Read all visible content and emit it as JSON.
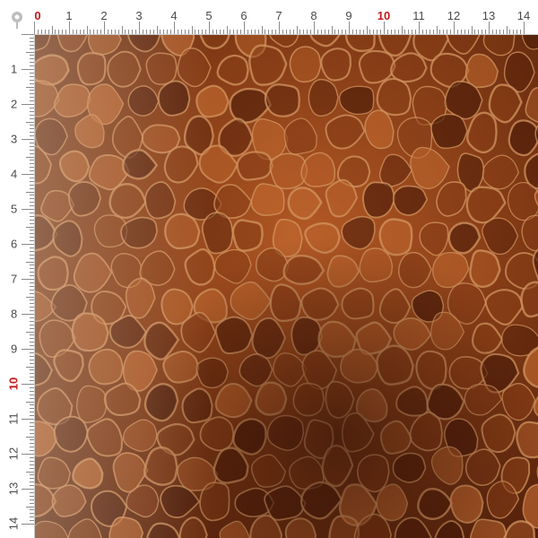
{
  "ruler": {
    "unit_labels": [
      "0",
      "1",
      "2",
      "3",
      "4",
      "5",
      "6",
      "7",
      "8",
      "9",
      "10",
      "11",
      "12",
      "13",
      "14"
    ],
    "highlight": [
      "0",
      "10"
    ],
    "highlight_color": "#c3191c"
  },
  "swatch": {
    "texture": "brown crocodile leather print",
    "colors": {
      "base_dark": "#4a1a08",
      "base_mid": "#8a3e16",
      "base_light": "#c56a30",
      "ridge": "#d89a63"
    }
  },
  "icons": {
    "corner": "pin-icon"
  }
}
